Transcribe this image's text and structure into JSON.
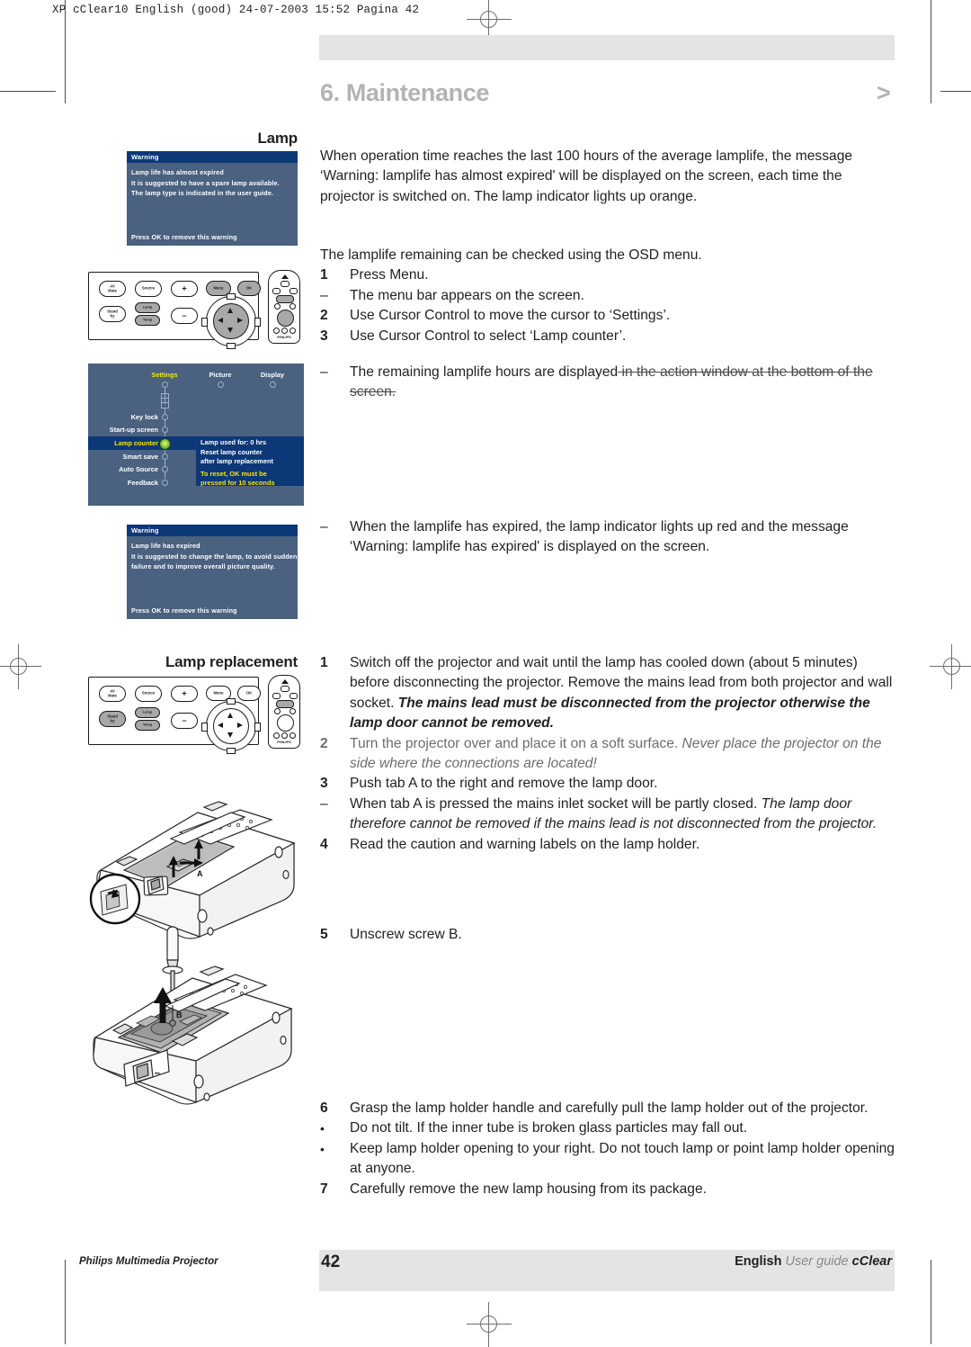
{
  "slug": "XP cClear10 English (good)  24-07-2003  15:52  Pagina 42",
  "header": {
    "chapter_title": "6. Maintenance",
    "chapter_arrow": ">"
  },
  "sections": {
    "lamp_heading": "Lamp",
    "lamp_replacement_heading": "Lamp replacement"
  },
  "lamp": {
    "intro": "When operation time reaches the last 100 hours of the average lamplife, the message ‘Warning: lamplife has almost expired' will be displayed on the screen, each time the projector is switched on. The lamp indicator lights up orange.",
    "osd_intro": "The lamplife remaining can be checked using the OSD menu.",
    "steps": [
      {
        "marker": "1",
        "type": "num",
        "text": "Press Menu."
      },
      {
        "marker": "–",
        "type": "dash",
        "text": "The menu bar appears on the screen."
      },
      {
        "marker": "2",
        "type": "num",
        "text": "Use Cursor Control to move the cursor to ‘Settings’."
      },
      {
        "marker": "3",
        "type": "num",
        "text": "Use Cursor Control to select ‘Lamp counter’."
      }
    ],
    "struck_step": {
      "marker": "–",
      "text_kept": "The remaining lamplife hours are displayed",
      "text_struck": " in the action window at the bottom of the screen."
    },
    "expired_step": {
      "marker": "–",
      "text": "When the lamplife has expired, the lamp indicator lights up red and the message ‘Warning: lamplife has expired' is displayed on the screen."
    }
  },
  "lamp_replacement": {
    "steps": [
      {
        "marker": "1",
        "type": "num",
        "faded": false,
        "text": "Switch off the projector and wait until the lamp has cooled down (about 5 minutes) before disconnecting the projector. Remove the mains lead from both projector and wall socket. ",
        "bold_italic": "The mains lead must be disconnected from the projector otherwise the lamp door cannot be removed."
      },
      {
        "marker": "2",
        "type": "num",
        "faded": true,
        "text": "Turn the projector over and place it on a soft surface. ",
        "italic": "Never place the projector on the side where the connections are located!"
      },
      {
        "marker": "3",
        "type": "num",
        "faded": false,
        "text": "Push tab A to the right and remove the lamp door."
      },
      {
        "marker": "–",
        "type": "dash",
        "faded": false,
        "text": "When tab A is pressed the mains inlet socket will be partly closed. ",
        "italic": "The lamp door therefore cannot be removed if the mains lead is not disconnected from the projector."
      },
      {
        "marker": "4",
        "type": "num",
        "faded": false,
        "text": "Read the caution and warning labels on the lamp holder."
      }
    ],
    "step5": {
      "marker": "5",
      "type": "num",
      "text": "Unscrew screw B."
    },
    "steps_tail": [
      {
        "marker": "6",
        "type": "num",
        "text": "Grasp the lamp holder handle and carefully pull the lamp holder out of the projector."
      },
      {
        "marker": "•",
        "type": "bullet",
        "text": "Do not tilt. If the inner tube is broken glass particles may fall out."
      },
      {
        "marker": "•",
        "type": "bullet",
        "text": "Keep lamp holder opening to your right. Do not touch lamp or point lamp holder opening at anyone."
      },
      {
        "marker": "7",
        "type": "num",
        "text": "Carefully remove the new lamp housing from its package."
      }
    ]
  },
  "osd_warning_almost": {
    "title": "Warning",
    "lines": [
      "Lamp life has almost expired",
      "It is suggested to have a spare lamp available.",
      "The lamp type is indicated in the user guide."
    ],
    "footer": "Press OK to remove this warning"
  },
  "osd_warning_expired": {
    "title": "Warning",
    "lines": [
      "Lamp life has expired",
      "It is suggested to change the lamp, to avoid sudden",
      "failure and to improve overall picture quality."
    ],
    "footer": "Press OK to remove this warning"
  },
  "osd_menu": {
    "tabs": [
      "Settings",
      "Picture",
      "Display"
    ],
    "rows": [
      "Key lock",
      "Start-up screen",
      "Lamp counter",
      "Smart save",
      "Auto Source",
      "Feedback"
    ],
    "selected_row": "Lamp counter",
    "action_lines_white": [
      "Lamp used for: 0 hrs",
      "Reset lamp counter",
      "after lamp replacement"
    ],
    "action_lines_yellow": [
      "To reset, OK must be",
      "pressed for 10 seconds"
    ]
  },
  "control_panel": {
    "buttons": [
      {
        "label": "AV\nMute",
        "filled": false
      },
      {
        "label": "Source",
        "filled": false
      },
      {
        "label": "+",
        "filled": false
      },
      {
        "label": "Menu",
        "filled": true
      },
      {
        "label": "OK",
        "filled": true
      },
      {
        "label": "Stand\nby",
        "filled": false
      },
      {
        "label": "–",
        "filled": false
      }
    ],
    "lamp_indicator": "Lamp",
    "temp_indicator": "Temp",
    "remote_brand": "PHILIPS"
  },
  "control_panel_2": {
    "buttons": [
      {
        "label": "AV\nMute",
        "filled": false
      },
      {
        "label": "Source",
        "filled": false
      },
      {
        "label": "+",
        "filled": false
      },
      {
        "label": "Menu",
        "filled": false
      },
      {
        "label": "OK",
        "filled": false
      },
      {
        "label": "Stand\nby",
        "filled": true
      },
      {
        "label": "–",
        "filled": false
      }
    ],
    "lamp_indicator": "Lamp",
    "temp_indicator": "Temp",
    "remote_brand": "PHILIPS"
  },
  "illustrations": {
    "tab_label_a": "A",
    "screw_label_b": "B"
  },
  "footer": {
    "left": "Philips Multimedia Projector",
    "page_number": "42",
    "right_en": "English",
    "right_ug": "User guide",
    "right_cc": "cClear"
  },
  "colors": {
    "osd_background": "#4a6180",
    "osd_bar": "#0d3878",
    "osd_yellow": "#f4e600",
    "band_gray": "#e4e4e4",
    "title_gray": "#b3b3b3"
  }
}
